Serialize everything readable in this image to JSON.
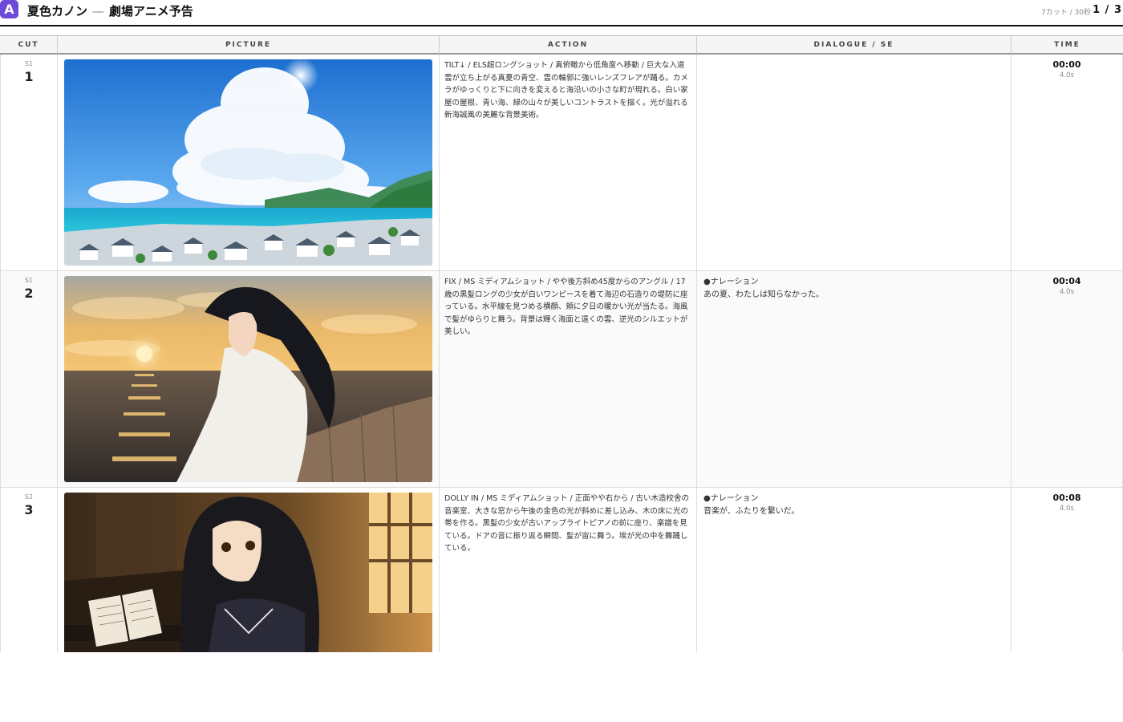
{
  "header": {
    "logo_letter": "A",
    "title": "夏色カノン",
    "separator": "—",
    "subtitle": "劇場アニメ予告",
    "meta": "7カット / 30秒",
    "page": "1 / 3"
  },
  "columns": {
    "cut": "CUT",
    "picture": "PICTURE",
    "action": "ACTION",
    "dialogue": "DIALOGUE / SE",
    "time": "TIME"
  },
  "rows": [
    {
      "scene": "S1",
      "cut": "1",
      "picture": "seaside-town-summer-clouds",
      "action": "TILT↓ / ELS超ロングショット / 真俯瞰から低角度へ移動 / 巨大な入道雲が立ち上がる真夏の青空、雲の輪郭に強いレンズフレアが踊る。カメラがゆっくりと下に向きを変えると海沿いの小さな町が現れる。白い家屋の屋根、青い海、緑の山々が美しいコントラストを描く。光が溢れる新海誠風の美麗な背景美術。",
      "dialogue_head": "",
      "dialogue": "",
      "time": "00:00",
      "duration": "4.0s"
    },
    {
      "scene": "S1",
      "cut": "2",
      "picture": "girl-seawall-sunset",
      "action": "FIX / MS ミディアムショット / やや後方斜め45度からのアングル / 17歳の黒髪ロングの少女が白いワンピースを着て海辺の石造りの堤防に座っている。水平線を見つめる横顔、頬に夕日の暖かい光が当たる。海風で髪がゆらりと舞う。背景は輝く海面と遠くの雲、逆光のシルエットが美しい。",
      "dialogue_head": "●ナレーション",
      "dialogue": "あの夏、わたしは知らなかった。",
      "time": "00:04",
      "duration": "4.0s"
    },
    {
      "scene": "S2",
      "cut": "3",
      "picture": "girl-piano-music-room",
      "action": "DOLLY IN / MS ミディアムショット / 正面やや右から / 古い木造校舎の音楽室、大きな窓から午後の金色の光が斜めに差し込み、木の床に光の帯を作る。黒髪の少女が古いアップライトピアノの前に座り、楽譜を見ている。ドアの音に振り返る瞬間、髪が宙に舞う。埃が光の中を舞踊している。",
      "dialogue_head": "●ナレーション",
      "dialogue": "音楽が、ふたりを繋いだ。",
      "time": "00:08",
      "duration": "4.0s"
    }
  ]
}
